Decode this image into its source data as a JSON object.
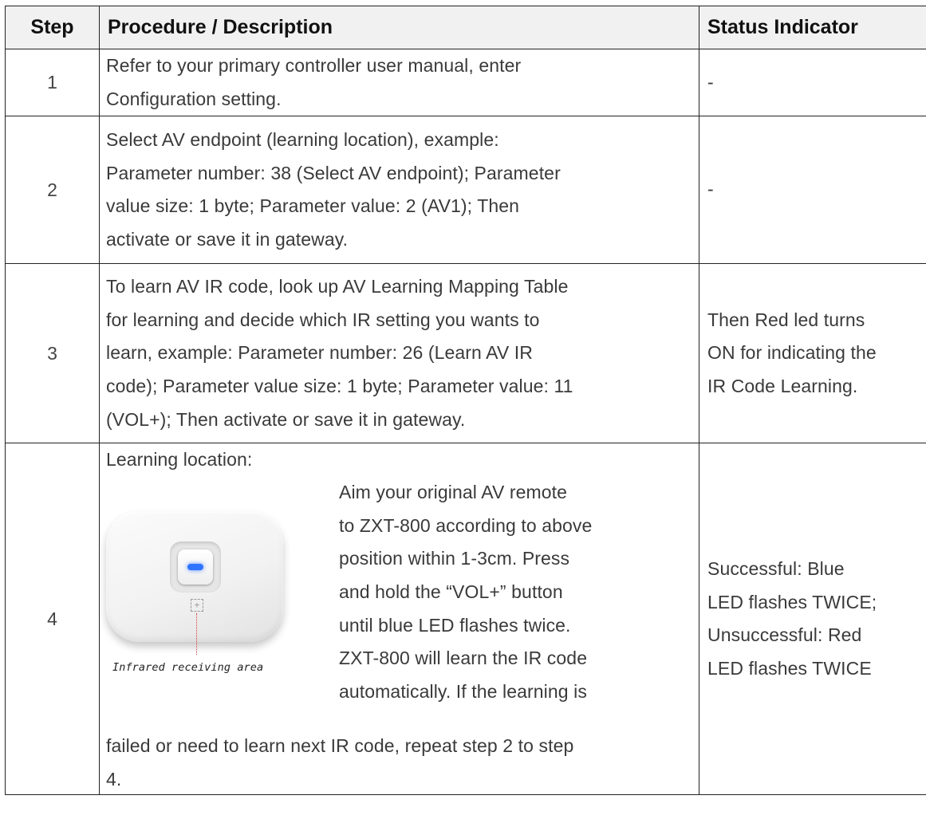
{
  "header": {
    "step": "Step",
    "procedure": "Procedure / Description",
    "status": "Status Indicator"
  },
  "rows": [
    {
      "step": "1",
      "lines": [
        "Refer to your primary controller user manual, enter",
        "Configuration setting."
      ],
      "status": "-"
    },
    {
      "step": "2",
      "lines": [
        "Select AV endpoint (learning location), example:",
        "Parameter number: 38 (Select AV endpoint); Parameter",
        "value size: 1 byte; Parameter value: 2 (AV1); Then",
        "activate or save it in gateway."
      ],
      "status": "-"
    },
    {
      "step": "3",
      "lines": [
        "To learn AV IR code, look up AV Learning Mapping Table",
        "for learning and decide which IR setting you wants to",
        "learn, example: Parameter number: 26 (Learn AV IR",
        "code); Parameter value size: 1 byte; Parameter value: 11",
        "(VOL+); Then activate or save it in gateway."
      ],
      "status_lines": [
        "Then Red led turns",
        "ON for indicating the",
        "IR Code Learning."
      ]
    },
    {
      "step": "4",
      "heading": "Learning location:",
      "figure_label": "Infrared receiving area",
      "right_lines": [
        "Aim your original AV remote",
        "to ZXT-800 according to above",
        "position within 1-3cm. Press",
        "and hold the “VOL+” button",
        "until blue LED flashes twice.",
        "ZXT-800 will learn the IR code",
        "automatically. If the learning is"
      ],
      "bottom_lines": [
        "failed or need to learn next IR code, repeat step 2 to step",
        "4."
      ],
      "status_lines": [
        "Successful: Blue",
        "LED flashes TWICE;",
        "Unsuccessful: Red",
        "LED flashes TWICE"
      ]
    }
  ],
  "colors": {
    "header_bg": "#f1f1f1",
    "border": "#222222",
    "led": "#2f74ff"
  }
}
